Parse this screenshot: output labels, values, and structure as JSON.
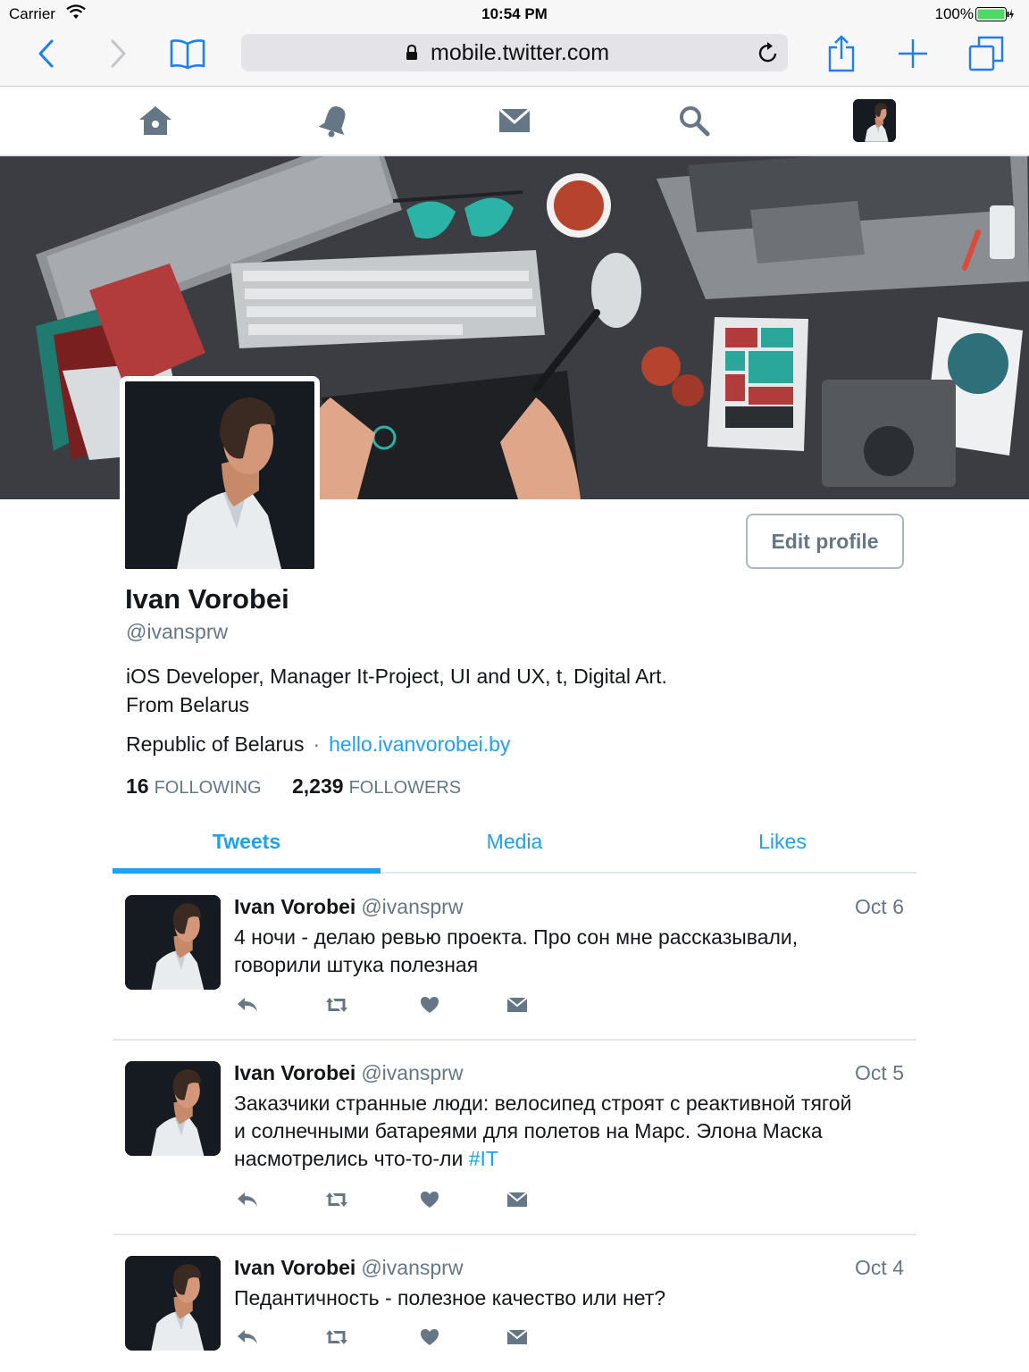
{
  "status_bar": {
    "carrier": "Carrier",
    "time": "10:54 PM",
    "battery": "100%"
  },
  "browser": {
    "url": "mobile.twitter.com"
  },
  "profile": {
    "display_name": "Ivan Vorobei",
    "screen_name": "@ivansprw",
    "bio_line1": "iOS Developer, Manager It-Project, UI and UX, t, Digital Art.",
    "bio_line2": "From Belarus",
    "location": "Republic of Belarus",
    "separator": "·",
    "website": "hello.ivanvorobei.by",
    "edit_label": "Edit profile",
    "following_count": "16",
    "following_label": "FOLLOWING",
    "followers_count": "2,239",
    "followers_label": "FOLLOWERS"
  },
  "tabs": [
    {
      "label": "Tweets"
    },
    {
      "label": "Media"
    },
    {
      "label": "Likes"
    }
  ],
  "tweets": [
    {
      "name": "Ivan Vorobei",
      "handle": "@ivansprw",
      "date": "Oct 6",
      "line1": "4 ночи - делаю ревью проекта. Про сон мне рассказывали,",
      "line2": "говорили штука полезная"
    },
    {
      "name": "Ivan Vorobei",
      "handle": "@ivansprw",
      "date": "Oct 5",
      "line1": "Заказчики странные люди: велосипед строят с реактивной тягой",
      "line2": "и солнечными батареями для полетов на Марс. Элона Маска",
      "line3": "насмотрелись что-то-ли",
      "hashtag": "#IT"
    },
    {
      "name": "Ivan Vorobei",
      "handle": "@ivansprw",
      "date": "Oct 4",
      "line1": "Педантичность - полезное качество или нет?"
    }
  ],
  "colors": {
    "accent": "#1da1f2",
    "muted": "#657786",
    "icon": "#657786",
    "banner": "#3b3d42"
  },
  "icons": [
    "back-icon",
    "forward-icon",
    "bookmarks-icon",
    "lock-icon",
    "reload-icon",
    "share-icon",
    "new-tab-icon",
    "tabs-icon",
    "home-icon",
    "notifications-icon",
    "messages-icon",
    "search-icon",
    "reply-icon",
    "retweet-icon",
    "like-icon",
    "dm-icon"
  ]
}
